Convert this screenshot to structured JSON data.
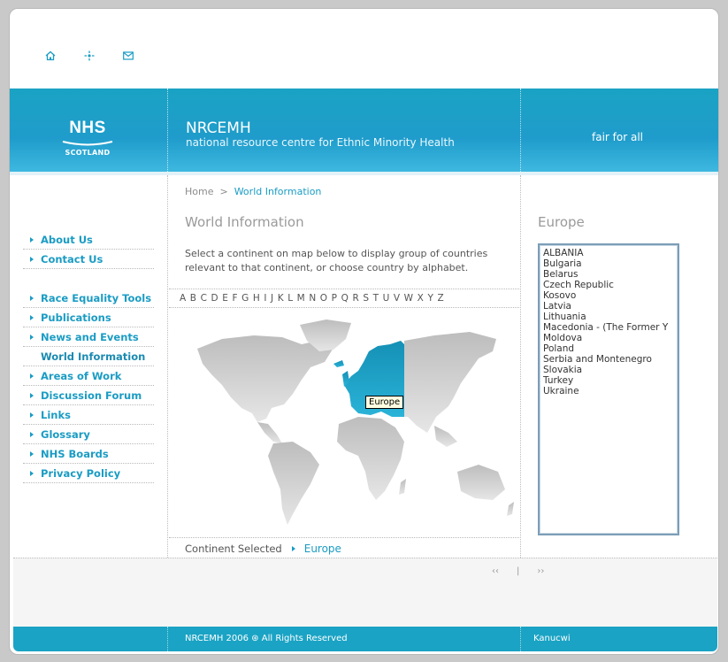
{
  "top_icons": [
    {
      "name": "home-icon"
    },
    {
      "name": "sitemap-icon"
    },
    {
      "name": "mail-icon"
    }
  ],
  "banner": {
    "logo_main": "NHS",
    "logo_sub": "SCOTLAND",
    "title": "NRCEMH",
    "subtitle": "national resource centre for Ethnic Minority Health",
    "tagline": "fair for all"
  },
  "sidebar": {
    "group1": [
      {
        "label": "About Us"
      },
      {
        "label": "Contact Us"
      }
    ],
    "group2": [
      {
        "label": "Race Equality Tools"
      },
      {
        "label": "Publications"
      },
      {
        "label": "News and Events"
      },
      {
        "label": "World Information",
        "current": true
      },
      {
        "label": "Areas of Work"
      },
      {
        "label": "Discussion Forum"
      },
      {
        "label": "Links"
      },
      {
        "label": "Glossary"
      },
      {
        "label": "NHS Boards"
      },
      {
        "label": "Privacy Policy"
      }
    ]
  },
  "breadcrumb": {
    "home": "Home",
    "separator": ">",
    "current": "World Information"
  },
  "main": {
    "title": "World Information",
    "intro": "Select a continent on map below to display group of countries relevant to that continent, or choose country by alphabet.",
    "alphabet": [
      "A",
      "B",
      "C",
      "D",
      "E",
      "F",
      "G",
      "H",
      "I",
      "J",
      "K",
      "L",
      "M",
      "N",
      "O",
      "P",
      "Q",
      "R",
      "S",
      "T",
      "U",
      "V",
      "W",
      "X",
      "Y",
      "Z"
    ],
    "map_tooltip": "Europe",
    "highlight_color": "#1aa3c4",
    "continent_label": "Continent Selected",
    "continent_value": "Europe"
  },
  "right": {
    "title": "Europe",
    "countries": [
      "ALBANIA",
      "Bulgaria",
      "Belarus",
      "Czech Republic",
      "Kosovo",
      "Latvia",
      "Lithuania",
      "Macedonia - (The Former Y",
      "Moldova",
      "Poland",
      "Serbia and Montenegro",
      "Slovakia",
      "Turkey",
      "Ukraine"
    ]
  },
  "pager": {
    "prev": "‹‹",
    "divider": "|",
    "next": "››"
  },
  "footer": {
    "copyright": "NRCEMH 2006  ⊛  All Rights Reserved",
    "credit": "Kanucwi"
  },
  "colors": {
    "accent": "#1aa3c4",
    "link": "#1a9cc4"
  }
}
